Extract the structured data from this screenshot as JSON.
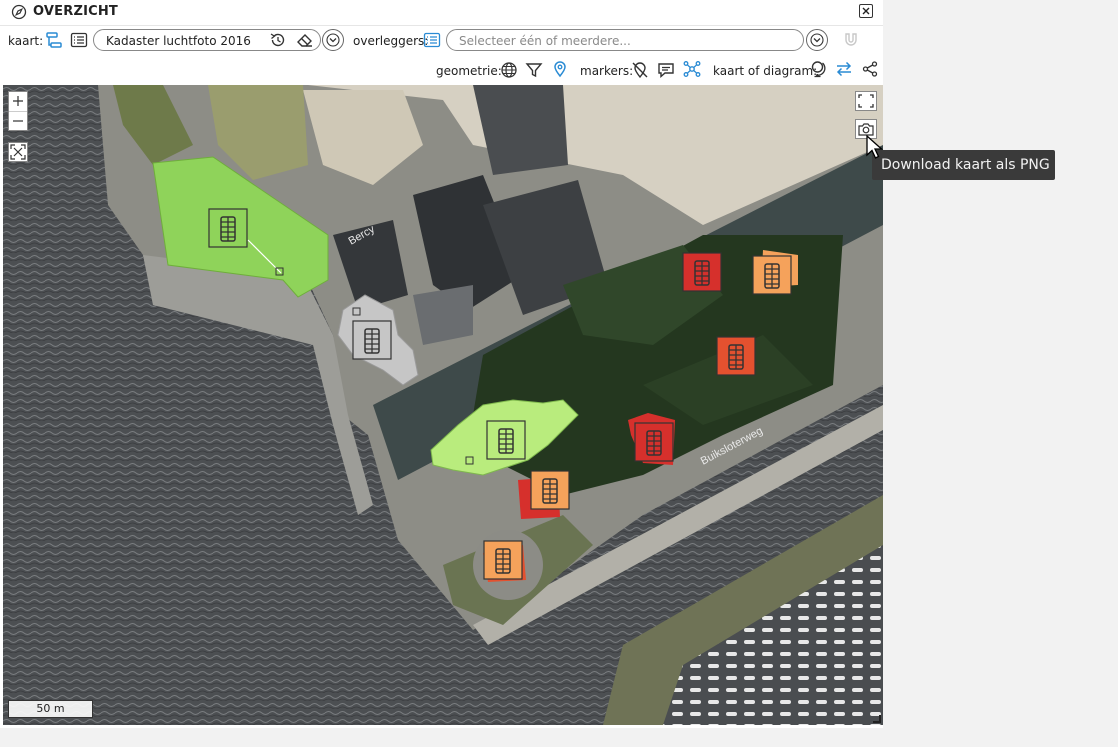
{
  "window": {
    "title": "OVERZICHT"
  },
  "toolbar": {
    "kaart_label": "kaart:",
    "kaart_value": "Kadaster luchtfoto 2016",
    "overleggers_label": "overleggers:",
    "overleggers_placeholder": "Selecteer één of meerdere...",
    "geometrie_label": "geometrie:",
    "markers_label": "markers:",
    "kaart_of_diagram_label": "kaart of diagram:"
  },
  "map": {
    "scale_label": "50 m",
    "tooltip": "Download kaart als PNG",
    "street_labels": [
      "Bercy",
      "Buiksloterweg"
    ]
  },
  "colors": {
    "accent": "#2a8bd4",
    "green_zone": "#8fd35a",
    "grey_zone": "#c6c6c6",
    "marker_red": "#d6302c",
    "marker_orange": "#f5a25b",
    "marker_darkorange": "#e4512f"
  }
}
